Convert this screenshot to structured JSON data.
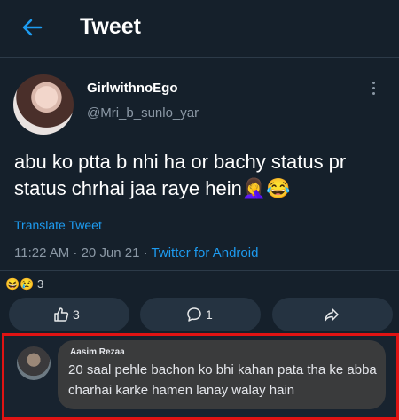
{
  "header": {
    "title": "Tweet"
  },
  "tweet": {
    "author_name": "GirlwithnoEgo",
    "author_handle": "@Mri_b_sunlo_yar",
    "text": "abu ko ptta b nhi ha or bachy status pr status chrhai jaa raye hein🤦‍♀️😂",
    "translate_label": "Translate Tweet",
    "timestamp": "11:22 AM · 20 Jun 21 · ",
    "source": "Twitter for Android"
  },
  "reactions": {
    "emojis": "😆😢",
    "count": "3"
  },
  "actions": {
    "like_count": "3",
    "reply_count": "1"
  },
  "comment": {
    "author": "Aasim Rezaa",
    "text": "20 saal pehle bachon ko bhi kahan pata tha ke abba charhai karke hamen lanay walay hain"
  },
  "colors": {
    "background": "#15202b",
    "accent": "#1d9bf0",
    "highlight_border": "#e01313"
  }
}
